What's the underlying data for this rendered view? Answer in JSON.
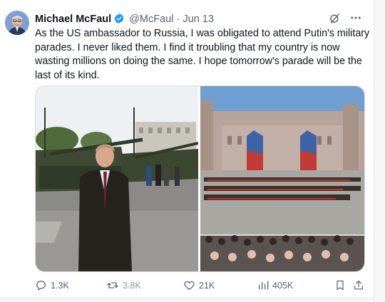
{
  "author": {
    "name": "Michael McFaul",
    "handle": "@McFaul",
    "separator": "·",
    "date": "Jun 13"
  },
  "tweet": {
    "text": "As the US ambassador to Russia, I was obligated to attend Putin's military parades. I never liked them. I find it troubling that my country is now wasting millions on doing the same.  I hope tomorrow's parade will be the last of its kind."
  },
  "icons": {
    "verified": "verified-badge-icon",
    "grok": "grok-icon",
    "more": "more-icon",
    "reply": "reply-icon",
    "retweet": "retweet-icon",
    "like": "like-icon",
    "views": "views-icon",
    "bookmark": "bookmark-icon",
    "share": "share-icon"
  },
  "stats": {
    "replies": "1.3K",
    "retweets": "3.8K",
    "likes": "21K",
    "views": "405K"
  },
  "colors": {
    "verified": "#1d9bf0",
    "text": "#0f1419",
    "secondary": "#536471"
  }
}
